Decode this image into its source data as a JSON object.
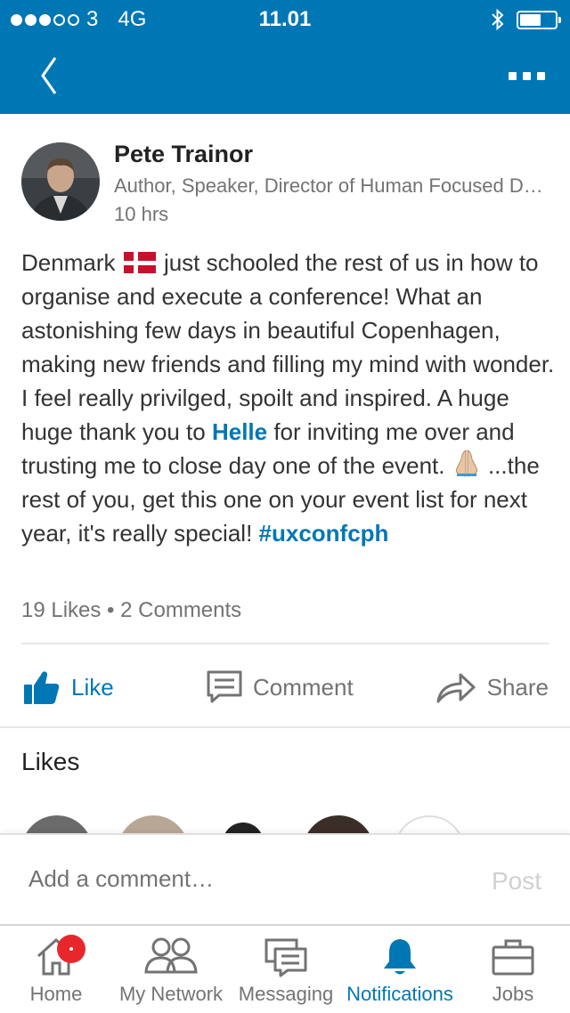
{
  "status_bar": {
    "carrier": "3",
    "network": "4G",
    "time": "11.01"
  },
  "nav": {
    "back_icon": "chevron-left-icon",
    "more_icon": "more-dots-icon"
  },
  "post": {
    "author_name": "Pete Trainor",
    "author_title": "Author, Speaker, Director of Human Focused Design",
    "time_ago": "10 hrs",
    "body": {
      "part1": "Denmark",
      "part2": " just schooled the rest of us in how to organise and execute a conference! What an astonishing few days in beautiful Copenhagen, making new friends and filling my mind with wonder. I feel really privilged, spoilt and inspired. A huge huge thank you to ",
      "mention": "Helle",
      "part3": " for inviting me over and trusting me to close day one of the event. ",
      "part4": " ...the rest of you, get this one on your event list for next year, it's really special! ",
      "hashtag": "#uxconfcph"
    },
    "stats": "19 Likes • 2 Comments"
  },
  "actions": {
    "like_label": "Like",
    "comment_label": "Comment",
    "share_label": "Share"
  },
  "likes_section": {
    "heading": "Likes"
  },
  "comment_box": {
    "placeholder": "Add a comment…",
    "post_label": "Post"
  },
  "tabs": [
    {
      "label": "Home",
      "icon": "home-icon"
    },
    {
      "label": "My Network",
      "icon": "network-icon"
    },
    {
      "label": "Messaging",
      "icon": "messaging-icon"
    },
    {
      "label": "Notifications",
      "icon": "bell-icon"
    },
    {
      "label": "Jobs",
      "icon": "briefcase-icon"
    }
  ],
  "colors": {
    "brand": "#0077b5",
    "badge": "#e8272d",
    "muted_text": "#737373"
  }
}
